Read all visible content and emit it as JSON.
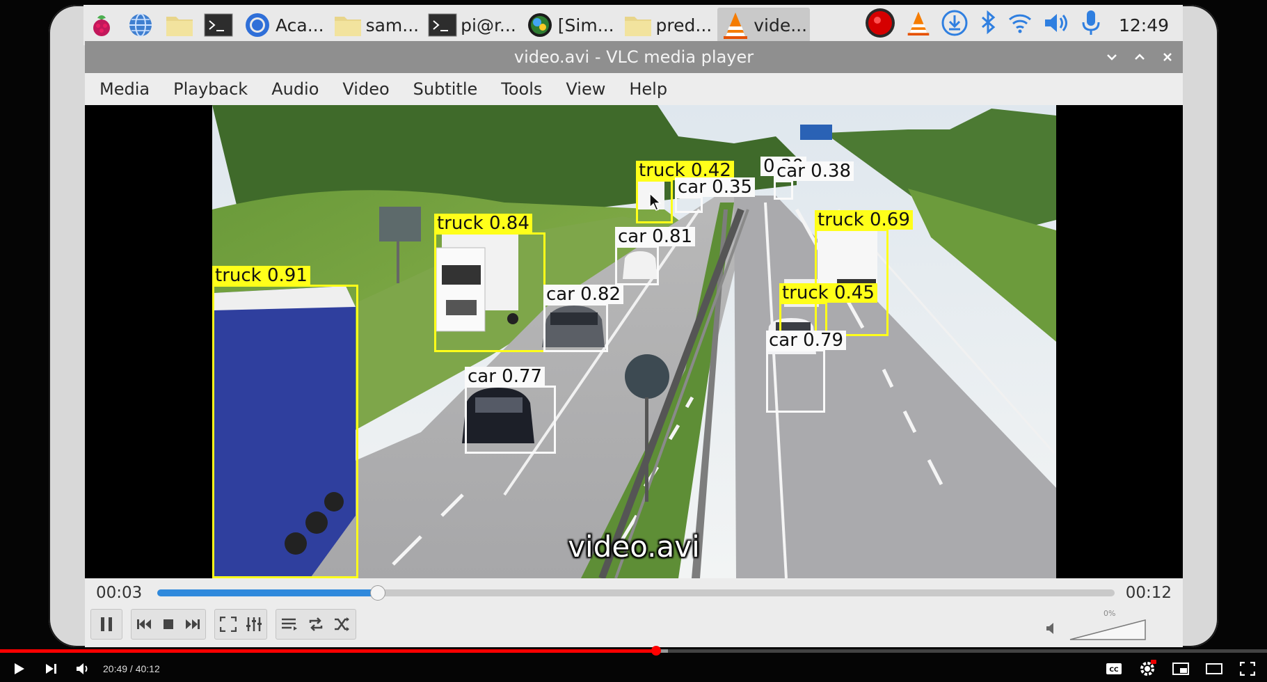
{
  "taskbar": {
    "apps": [
      {
        "icon": "raspberry-menu-icon",
        "label": ""
      },
      {
        "icon": "globe-icon",
        "label": ""
      },
      {
        "icon": "folder-icon",
        "label": ""
      },
      {
        "icon": "terminal-icon",
        "label": ""
      },
      {
        "icon": "chromium-icon",
        "label": "Aca..."
      },
      {
        "icon": "folder-icon",
        "label": "sam..."
      },
      {
        "icon": "terminal-icon",
        "label": "pi@r..."
      },
      {
        "icon": "sim-icon",
        "label": "[Sim..."
      },
      {
        "icon": "folder-icon",
        "label": "pred..."
      },
      {
        "icon": "vlc-icon",
        "label": "vide..."
      }
    ],
    "tray": [
      "record-icon",
      "vlc-icon",
      "download-icon",
      "bluetooth-icon",
      "wifi-icon",
      "volume-icon",
      "microphone-icon"
    ],
    "clock": "12:49"
  },
  "window": {
    "title": "video.avi - VLC media player"
  },
  "menu": [
    "Media",
    "Playback",
    "Audio",
    "Video",
    "Subtitle",
    "Tools",
    "View",
    "Help"
  ],
  "detections": [
    {
      "label": "truck 0.91",
      "cls": "truck"
    },
    {
      "label": "truck 0.84",
      "cls": "truck"
    },
    {
      "label": "car 0.82",
      "cls": "car"
    },
    {
      "label": "car 0.77",
      "cls": "car"
    },
    {
      "label": "car 0.81",
      "cls": "car"
    },
    {
      "label": "truck 0.42",
      "cls": "truck"
    },
    {
      "label": "0.30",
      "cls": "car"
    },
    {
      "label": "car 0.35",
      "cls": "car"
    },
    {
      "label": "car 0.38",
      "cls": "car"
    },
    {
      "label": "truck 0.69",
      "cls": "truck"
    },
    {
      "label": "truck 0.45",
      "cls": "truck"
    },
    {
      "label": "car 0.79",
      "cls": "car"
    }
  ],
  "subtitle": "video.avi",
  "playback": {
    "elapsed": "00:03",
    "total": "00:12",
    "progress_fraction": 0.23,
    "volume_label": "0%"
  },
  "youtube": {
    "time": "20:49 / 40:12",
    "progress_fraction": 0.518,
    "buffer_fraction": 0.527
  },
  "colors": {
    "detection_truck": "#ffff1a",
    "detection_car": "#fafafa",
    "seek_fill": "#2f89dc",
    "youtube_red": "#ff0000"
  }
}
